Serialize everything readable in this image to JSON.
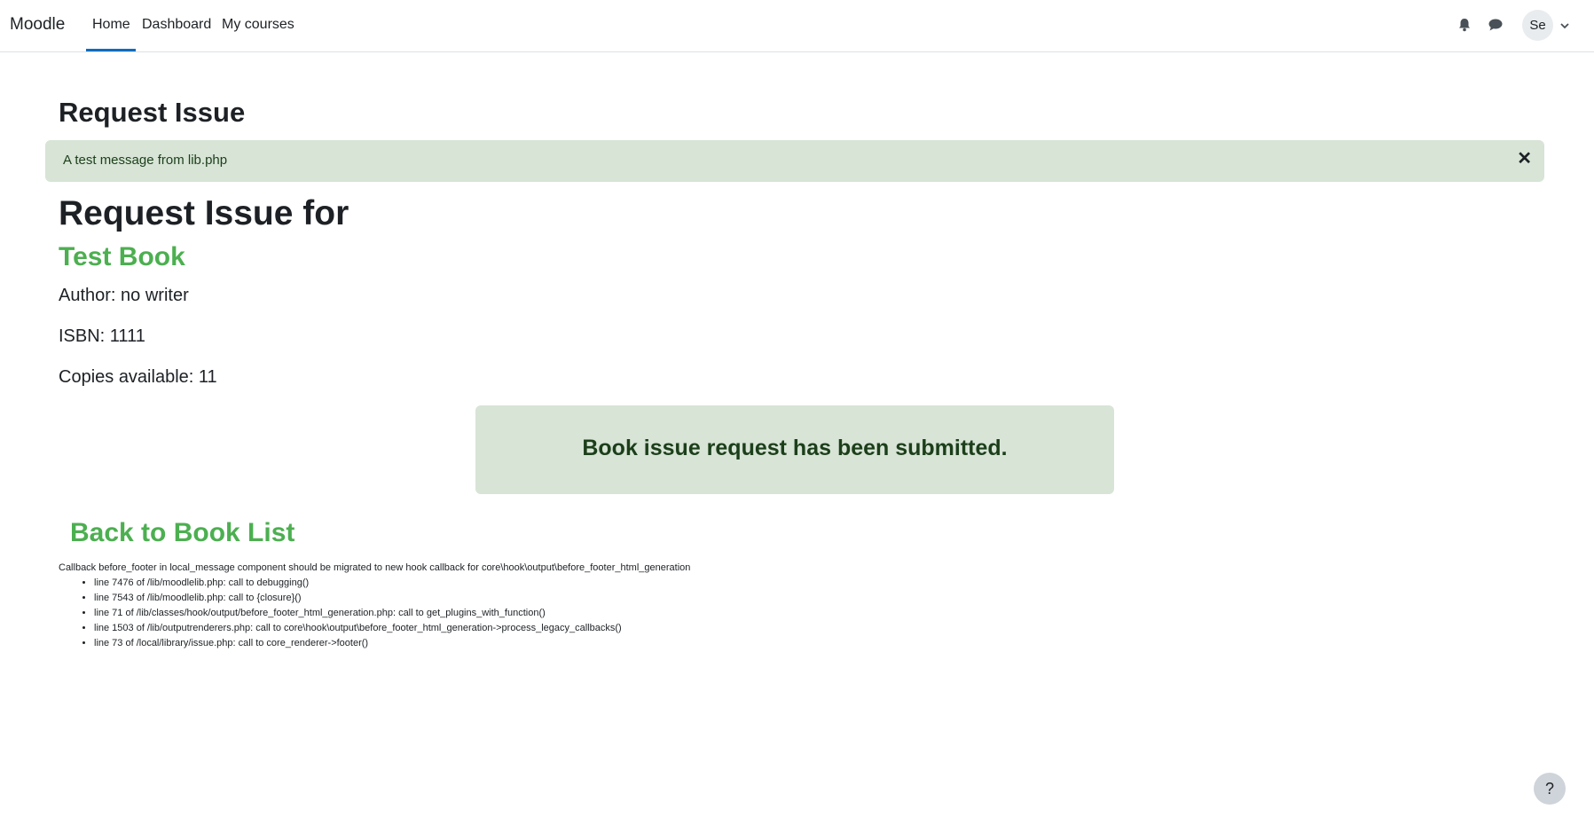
{
  "navbar": {
    "brand": "Moodle",
    "links": [
      {
        "label": "Home",
        "active": true
      },
      {
        "label": "Dashboard"
      },
      {
        "label": "My courses"
      }
    ],
    "icons": [
      "bell-icon",
      "chat-icon",
      "chevron-down-icon"
    ],
    "avatar_initials": "Se",
    "accent_color": "#0f6cbf"
  },
  "page": {
    "title": "Request Issue"
  },
  "alert": {
    "message": "A test message from lib.php",
    "close_label": "✕",
    "background": "#d7e4d6"
  },
  "request": {
    "heading": "Request Issue for",
    "book_title": "Test Book",
    "author": "Author: no writer",
    "isbn": "ISBN: 1111",
    "copies": "Copies available: 11",
    "title_color": "#4caf50"
  },
  "success": {
    "message": "Book issue request has been submitted."
  },
  "back_link": "Back to Book List",
  "debug": {
    "message": "Callback before_footer in local_message component should be migrated to new hook callback for core\\hook\\output\\before_footer_html_generation",
    "trace": [
      "line 7476 of /lib/moodlelib.php: call to debugging()",
      "line 7543 of /lib/moodlelib.php: call to {closure}()",
      "line 71 of /lib/classes/hook/output/before_footer_html_generation.php: call to get_plugins_with_function()",
      "line 1503 of /lib/outputrenderers.php: call to core\\hook\\output\\before_footer_html_generation->process_legacy_callbacks()",
      "line 73 of /local/library/issue.php: call to core_renderer->footer()"
    ]
  },
  "help": {
    "label": "?"
  }
}
